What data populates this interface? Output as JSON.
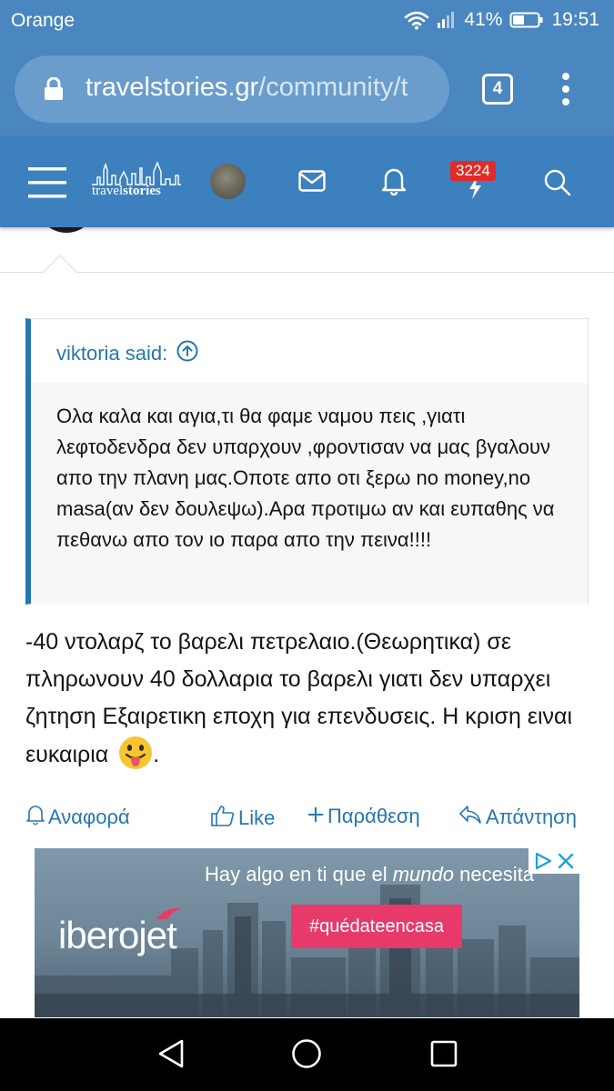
{
  "status_bar": {
    "carrier": "Orange",
    "battery": "41%",
    "time": "19:51"
  },
  "browser": {
    "url_domain": "travelstories.gr",
    "url_path": "/community/t",
    "tab_count": "4"
  },
  "site_nav": {
    "logo_text_light": "travel",
    "logo_text_bold": "stories",
    "alerts_badge": "3224"
  },
  "quote": {
    "author": "viktoria said:",
    "text": "Ολα καλα και αγια,τι θα φαμε ναμου πεις ,γιατι λεφτοδενδρα δεν υπαρχουν ,φροντισαν να μας βγαλουν απο την πλανη μας.Οποτε απο οτι ξερω no money,no masa(αν δεν δουλεψω).Αρα προτιμω αν και ευπαθης να πεθανω απο τον ιο παρα απο την πεινα!!!!"
  },
  "post": {
    "text": "-40 ντολαρζ το βαρελι πετρελαιο.(Θεωρητικα) σε πληρωνουν 40 δολλαρια το βαρελι γιατι δεν υπαρχει ζητηση Εξαιρετικη εποχη για επενδυσεις. Η κριση ειναι ευκαιρια",
    "text_end": "."
  },
  "actions": {
    "report": "Αναφορά",
    "like": "Like",
    "quote": "Παράθεση",
    "reply": "Απάντηση"
  },
  "ad": {
    "tagline_start": "Hay algo en ti que el ",
    "tagline_italic": "mundo",
    "tagline_end": " necesita",
    "brand": "iberojet",
    "hashtag": "#quédateencasa"
  },
  "colors": {
    "header_blue": "#3d80be",
    "link_blue": "#2577b1",
    "badge_red": "#e02b27",
    "ad_pink": "#e73a6b"
  }
}
